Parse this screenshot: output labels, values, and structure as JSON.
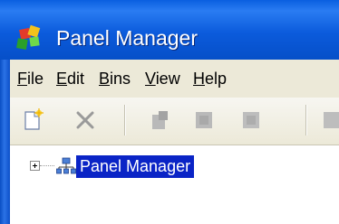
{
  "window": {
    "title": "Panel Manager",
    "app_icon": "colored-blocks-icon"
  },
  "menu": {
    "items": [
      {
        "label": "File",
        "mnemonic": "F"
      },
      {
        "label": "Edit",
        "mnemonic": "E"
      },
      {
        "label": "Bins",
        "mnemonic": "B"
      },
      {
        "label": "View",
        "mnemonic": "V"
      },
      {
        "label": "Help",
        "mnemonic": "H"
      }
    ]
  },
  "toolbar": {
    "buttons": [
      {
        "icon": "new-document-icon",
        "enabled": true
      },
      {
        "icon": "delete-icon",
        "enabled": false
      },
      {
        "icon": "panel-icon",
        "enabled": false
      },
      {
        "icon": "panel-icon",
        "enabled": false
      },
      {
        "icon": "panel-icon",
        "enabled": false
      },
      {
        "icon": "panel-icon",
        "enabled": false
      }
    ]
  },
  "tree": {
    "root": {
      "label": "Panel Manager",
      "icon": "network-icon",
      "expanded": false,
      "selected": true
    }
  },
  "colors": {
    "titlebar": "#0b5bdc",
    "selection": "#0a24c6",
    "menubar": "#ece9d8"
  }
}
